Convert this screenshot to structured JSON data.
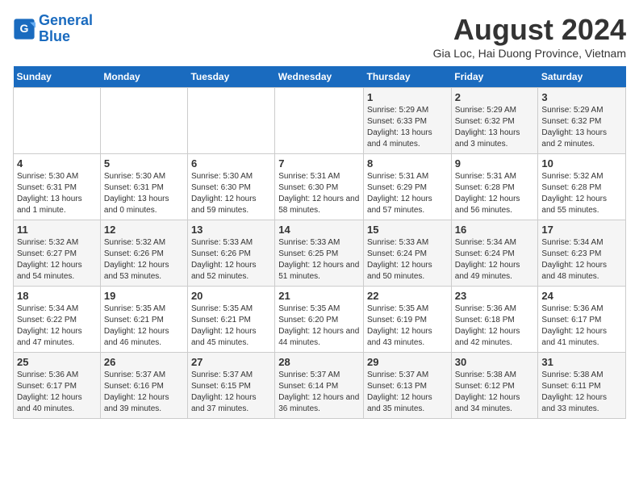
{
  "logo": {
    "line1": "General",
    "line2": "Blue"
  },
  "title": "August 2024",
  "subtitle": "Gia Loc, Hai Duong Province, Vietnam",
  "days_of_week": [
    "Sunday",
    "Monday",
    "Tuesday",
    "Wednesday",
    "Thursday",
    "Friday",
    "Saturday"
  ],
  "weeks": [
    [
      {
        "day": "",
        "sunrise": "",
        "sunset": "",
        "daylight": ""
      },
      {
        "day": "",
        "sunrise": "",
        "sunset": "",
        "daylight": ""
      },
      {
        "day": "",
        "sunrise": "",
        "sunset": "",
        "daylight": ""
      },
      {
        "day": "",
        "sunrise": "",
        "sunset": "",
        "daylight": ""
      },
      {
        "day": "1",
        "sunrise": "5:29 AM",
        "sunset": "6:33 PM",
        "daylight": "13 hours and 4 minutes."
      },
      {
        "day": "2",
        "sunrise": "5:29 AM",
        "sunset": "6:32 PM",
        "daylight": "13 hours and 3 minutes."
      },
      {
        "day": "3",
        "sunrise": "5:29 AM",
        "sunset": "6:32 PM",
        "daylight": "13 hours and 2 minutes."
      }
    ],
    [
      {
        "day": "4",
        "sunrise": "5:30 AM",
        "sunset": "6:31 PM",
        "daylight": "13 hours and 1 minute."
      },
      {
        "day": "5",
        "sunrise": "5:30 AM",
        "sunset": "6:31 PM",
        "daylight": "13 hours and 0 minutes."
      },
      {
        "day": "6",
        "sunrise": "5:30 AM",
        "sunset": "6:30 PM",
        "daylight": "12 hours and 59 minutes."
      },
      {
        "day": "7",
        "sunrise": "5:31 AM",
        "sunset": "6:30 PM",
        "daylight": "12 hours and 58 minutes."
      },
      {
        "day": "8",
        "sunrise": "5:31 AM",
        "sunset": "6:29 PM",
        "daylight": "12 hours and 57 minutes."
      },
      {
        "day": "9",
        "sunrise": "5:31 AM",
        "sunset": "6:28 PM",
        "daylight": "12 hours and 56 minutes."
      },
      {
        "day": "10",
        "sunrise": "5:32 AM",
        "sunset": "6:28 PM",
        "daylight": "12 hours and 55 minutes."
      }
    ],
    [
      {
        "day": "11",
        "sunrise": "5:32 AM",
        "sunset": "6:27 PM",
        "daylight": "12 hours and 54 minutes."
      },
      {
        "day": "12",
        "sunrise": "5:32 AM",
        "sunset": "6:26 PM",
        "daylight": "12 hours and 53 minutes."
      },
      {
        "day": "13",
        "sunrise": "5:33 AM",
        "sunset": "6:26 PM",
        "daylight": "12 hours and 52 minutes."
      },
      {
        "day": "14",
        "sunrise": "5:33 AM",
        "sunset": "6:25 PM",
        "daylight": "12 hours and 51 minutes."
      },
      {
        "day": "15",
        "sunrise": "5:33 AM",
        "sunset": "6:24 PM",
        "daylight": "12 hours and 50 minutes."
      },
      {
        "day": "16",
        "sunrise": "5:34 AM",
        "sunset": "6:24 PM",
        "daylight": "12 hours and 49 minutes."
      },
      {
        "day": "17",
        "sunrise": "5:34 AM",
        "sunset": "6:23 PM",
        "daylight": "12 hours and 48 minutes."
      }
    ],
    [
      {
        "day": "18",
        "sunrise": "5:34 AM",
        "sunset": "6:22 PM",
        "daylight": "12 hours and 47 minutes."
      },
      {
        "day": "19",
        "sunrise": "5:35 AM",
        "sunset": "6:21 PM",
        "daylight": "12 hours and 46 minutes."
      },
      {
        "day": "20",
        "sunrise": "5:35 AM",
        "sunset": "6:21 PM",
        "daylight": "12 hours and 45 minutes."
      },
      {
        "day": "21",
        "sunrise": "5:35 AM",
        "sunset": "6:20 PM",
        "daylight": "12 hours and 44 minutes."
      },
      {
        "day": "22",
        "sunrise": "5:35 AM",
        "sunset": "6:19 PM",
        "daylight": "12 hours and 43 minutes."
      },
      {
        "day": "23",
        "sunrise": "5:36 AM",
        "sunset": "6:18 PM",
        "daylight": "12 hours and 42 minutes."
      },
      {
        "day": "24",
        "sunrise": "5:36 AM",
        "sunset": "6:17 PM",
        "daylight": "12 hours and 41 minutes."
      }
    ],
    [
      {
        "day": "25",
        "sunrise": "5:36 AM",
        "sunset": "6:17 PM",
        "daylight": "12 hours and 40 minutes."
      },
      {
        "day": "26",
        "sunrise": "5:37 AM",
        "sunset": "6:16 PM",
        "daylight": "12 hours and 39 minutes."
      },
      {
        "day": "27",
        "sunrise": "5:37 AM",
        "sunset": "6:15 PM",
        "daylight": "12 hours and 37 minutes."
      },
      {
        "day": "28",
        "sunrise": "5:37 AM",
        "sunset": "6:14 PM",
        "daylight": "12 hours and 36 minutes."
      },
      {
        "day": "29",
        "sunrise": "5:37 AM",
        "sunset": "6:13 PM",
        "daylight": "12 hours and 35 minutes."
      },
      {
        "day": "30",
        "sunrise": "5:38 AM",
        "sunset": "6:12 PM",
        "daylight": "12 hours and 34 minutes."
      },
      {
        "day": "31",
        "sunrise": "5:38 AM",
        "sunset": "6:11 PM",
        "daylight": "12 hours and 33 minutes."
      }
    ]
  ],
  "labels": {
    "sunrise": "Sunrise:",
    "sunset": "Sunset:",
    "daylight": "Daylight:"
  }
}
